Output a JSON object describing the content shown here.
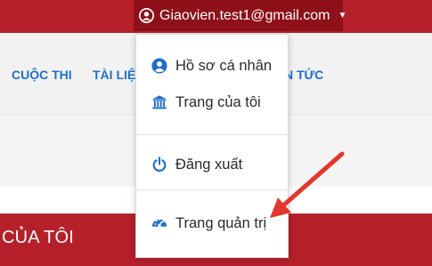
{
  "header": {
    "user_email": "Giaovien.test1@gmail.com"
  },
  "nav": {
    "items": [
      "CUỘC THI",
      "TÀI LIỆU",
      "N TỨC"
    ]
  },
  "dropdown": {
    "items": [
      {
        "label": "Hồ sơ cá nhân",
        "icon": "user-circle-icon"
      },
      {
        "label": "Trang của tôi",
        "icon": "bank-building-icon"
      },
      {
        "label": "Đăng xuất",
        "icon": "power-icon"
      },
      {
        "label": "Trang quản trị",
        "icon": "dashboard-gauge-icon"
      }
    ]
  },
  "section": {
    "title": "CỦA TÔI"
  },
  "colors": {
    "brand_red": "#b5202a",
    "dark_red": "#8e1019",
    "link_blue": "#1e6fc9",
    "arrow_red": "#e4362c"
  }
}
